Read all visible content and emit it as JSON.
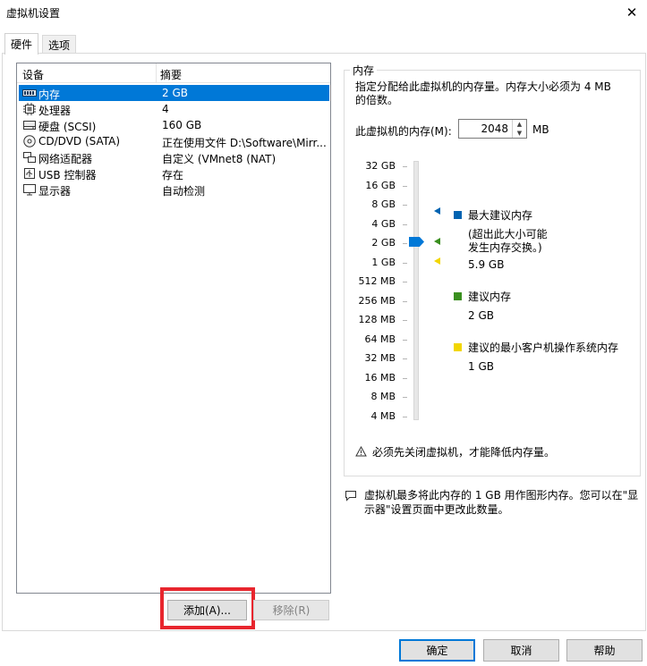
{
  "window": {
    "title": "虚拟机设置",
    "close_glyph": "✕"
  },
  "tabs": [
    {
      "label": "硬件",
      "active": true
    },
    {
      "label": "选项",
      "active": false
    }
  ],
  "device_list": {
    "columns": [
      "设备",
      "摘要"
    ],
    "rows": [
      {
        "icon": "memory-icon",
        "name": "内存",
        "summary": "2 GB",
        "selected": true
      },
      {
        "icon": "cpu-icon",
        "name": "处理器",
        "summary": "4",
        "selected": false
      },
      {
        "icon": "hard-disk-icon",
        "name": "硬盘 (SCSI)",
        "summary": "160 GB",
        "selected": false
      },
      {
        "icon": "cd-dvd-icon",
        "name": "CD/DVD (SATA)",
        "summary": "正在使用文件 D:\\Software\\Mirr...",
        "selected": false
      },
      {
        "icon": "network-adapter-icon",
        "name": "网络适配器",
        "summary": "自定义 (VMnet8 (NAT)",
        "selected": false
      },
      {
        "icon": "usb-icon",
        "name": "USB 控制器",
        "summary": "存在",
        "selected": false
      },
      {
        "icon": "display-icon",
        "name": "显示器",
        "summary": "自动检测",
        "selected": false
      }
    ]
  },
  "left_buttons": {
    "add": "添加(A)...",
    "remove": "移除(R)"
  },
  "memory": {
    "group_title": "内存",
    "description": "指定分配给此虚拟机的内存量。内存大小必须为 4 MB 的倍数。",
    "field_label": "此虚拟机的内存(M):",
    "value": "2048",
    "unit": "MB",
    "ticks": [
      "32 GB",
      "16 GB",
      "8 GB",
      "4 GB",
      "2 GB",
      "1 GB",
      "512 MB",
      "256 MB",
      "128 MB",
      "64 MB",
      "32 MB",
      "16 MB",
      "8 MB",
      "4 MB"
    ],
    "legend": {
      "max": {
        "title": "最大建议内存",
        "note": "(超出此大小可能发生内存交换。)",
        "value": "5.9 GB",
        "color": "#0063b1"
      },
      "recommended": {
        "title": "建议内存",
        "value": "2 GB",
        "color": "#3a8f1f"
      },
      "min": {
        "title": "建议的最小客户机操作系统内存",
        "value": "1 GB",
        "color": "#f2d600"
      }
    },
    "warning": "必须先关闭虚拟机，才能降低内存量。",
    "info": "虚拟机最多将此内存的 1 GB 用作图形内存。您可以在\"显示器\"设置页面中更改此数量。"
  },
  "bottom_buttons": {
    "ok": "确定",
    "cancel": "取消",
    "help": "帮助"
  },
  "colors": {
    "selection": "#0078d7",
    "highlight_box": "#e8262e"
  }
}
